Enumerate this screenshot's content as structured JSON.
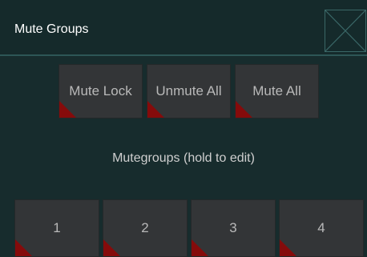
{
  "window": {
    "title": "Mute Groups",
    "close_icon": "close-x-icon"
  },
  "actions": [
    {
      "label": "Mute Lock"
    },
    {
      "label": "Unmute All"
    },
    {
      "label": "Mute All"
    }
  ],
  "mutegroups": {
    "heading": "Mutegroups (hold to edit)",
    "groups": [
      {
        "label": "1"
      },
      {
        "label": "2"
      },
      {
        "label": "3"
      },
      {
        "label": "4"
      }
    ]
  },
  "colors": {
    "background": "#172c2d",
    "title_bar": "#152a2b",
    "title_divider": "#2d5656",
    "button": "#333537",
    "button_text": "#b9b9b9",
    "mute_indicator": "#850b0b"
  }
}
